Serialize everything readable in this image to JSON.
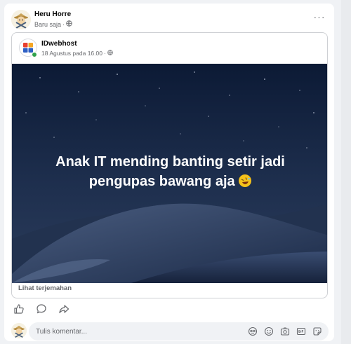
{
  "post": {
    "author": "Heru Horre",
    "time": "Baru saja",
    "separator": "·",
    "more_label": "···"
  },
  "shared": {
    "page_name": "IDwebhost",
    "date": "18 Agustus pada 16.00",
    "separator": "·",
    "caption_line1": "Anak IT mending banting setir jadi",
    "caption_line2": "pengupas bawang aja",
    "caption_emoji": "rolling-on-floor-laughing-emoji",
    "translate_link": "Lihat terjemahan"
  },
  "actions": {
    "icons": [
      "like-icon",
      "comment-icon",
      "share-icon"
    ]
  },
  "comment": {
    "placeholder": "Tulis komentar...",
    "tools": [
      "avatar-sticker-icon",
      "emoji-icon",
      "camera-icon",
      "gif-icon",
      "sticker-icon"
    ]
  },
  "colors": {
    "meta_text": "#65676b",
    "online": "#31a24c",
    "sky_top": "#0d1a33",
    "sky_bottom": "#23324f"
  }
}
